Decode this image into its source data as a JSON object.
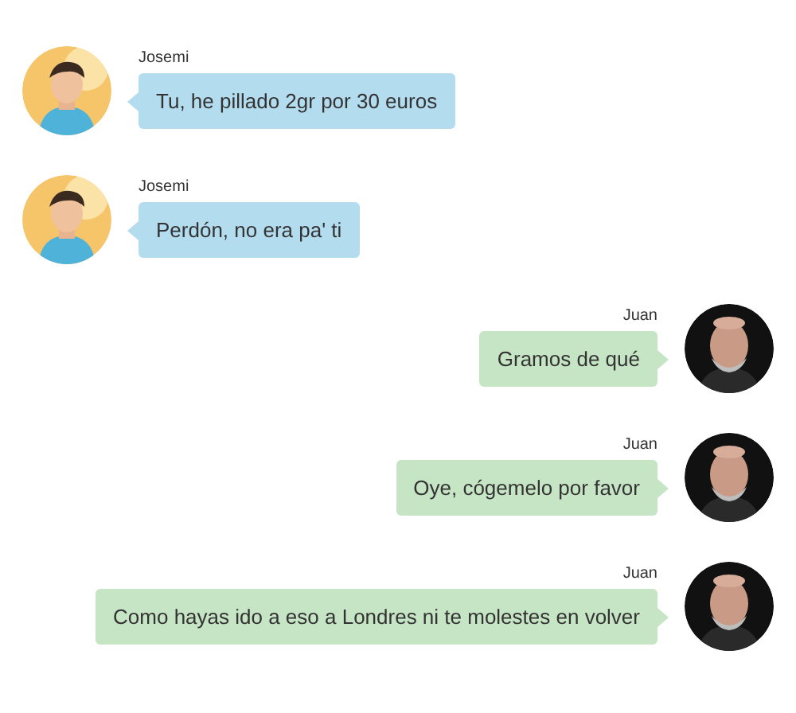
{
  "messages": [
    {
      "sender": "Josemi",
      "text": "Tu, he pillado 2gr por 30 euros",
      "kind": "incoming"
    },
    {
      "sender": "Josemi",
      "text": "Perdón, no era pa' ti",
      "kind": "incoming"
    },
    {
      "sender": "Juan",
      "text": "Gramos de qué",
      "kind": "outgoing"
    },
    {
      "sender": "Juan",
      "text": "Oye, cógemelo por favor",
      "kind": "outgoing"
    },
    {
      "sender": "Juan",
      "text": "Como hayas ido a eso a Londres ni te molestes en volver",
      "kind": "outgoing"
    }
  ]
}
